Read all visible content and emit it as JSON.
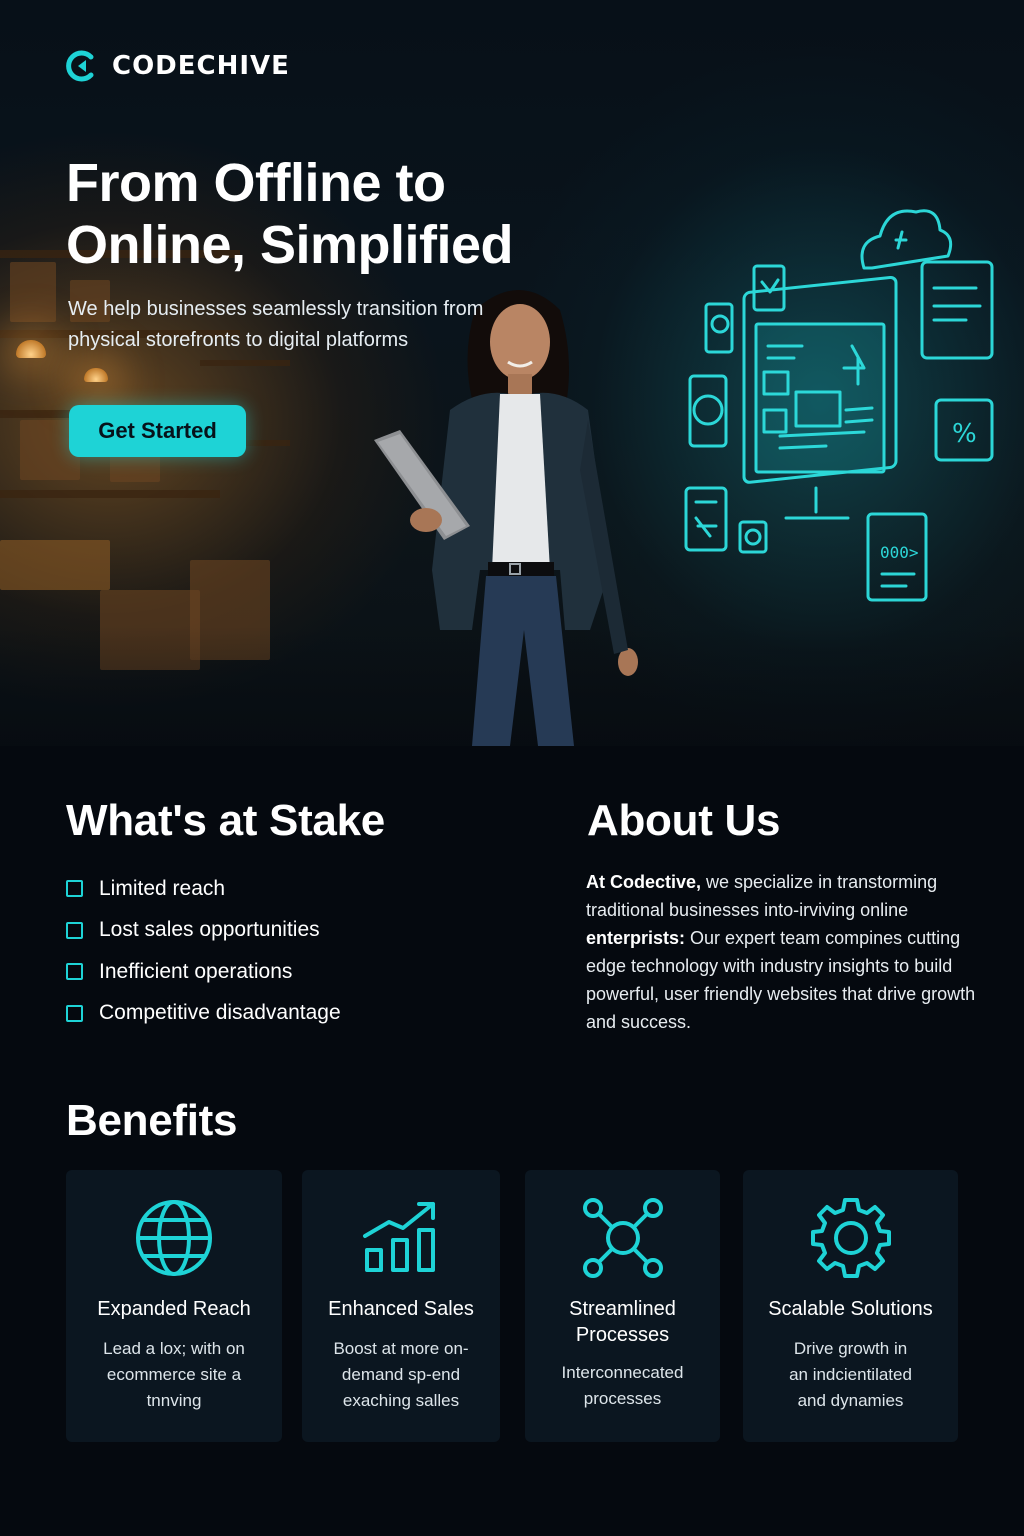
{
  "brand": {
    "name": "CODECHIVE",
    "accent": "#1ed3d6",
    "background": "#05090f"
  },
  "hero": {
    "title": "From Offline to Online, Simplified",
    "subtitle": "We help businesses seamlessly transition from physical storefronts to digital platforms",
    "cta_label": "Get Started"
  },
  "stake": {
    "heading": "What's at Stake",
    "items": [
      "Limited reach",
      "Lost sales opportunities",
      "Inefficient operations",
      "Competitive disadvantage"
    ]
  },
  "about": {
    "heading": "About Us",
    "p1_bold": "At Codective,",
    "p1": " we specialize in transtorming traditional businesses into-irviving online ",
    "p2_bold": "enterprists:",
    "p2": " Our expert team compines cutting edge technology with industry insights to build powerful, user friendly websites that drive growth and success."
  },
  "benefits": {
    "heading": "Benefits",
    "cards": [
      {
        "icon": "globe-icon",
        "title": "Expanded Reach",
        "desc": "Lead a lox; with on ecommerce site a tnnving"
      },
      {
        "icon": "growth-chart-icon",
        "title": "Enhanced Sales",
        "desc": "Boost at more on-demand sp-end exaching salles"
      },
      {
        "icon": "network-icon",
        "title": "Streamlined Processes",
        "desc": "Interconnecated processes"
      },
      {
        "icon": "gear-icon",
        "title": "Scalable Solutions",
        "desc": "Drive growth in an indcientilated and dynamies"
      }
    ]
  },
  "hologram": {
    "digit": "4",
    "percent": "%",
    "code": "000>"
  }
}
